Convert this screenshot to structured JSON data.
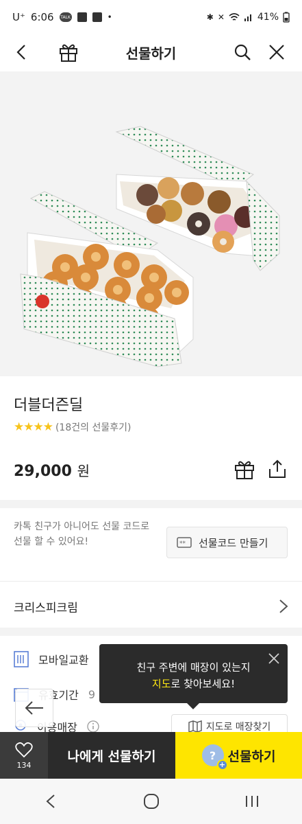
{
  "status_bar": {
    "carrier": "U⁺",
    "time": "6:06",
    "talk_badge": "TALK",
    "battery": "41%"
  },
  "header": {
    "title": "선물하기"
  },
  "product": {
    "name": "더블더즌딜",
    "stars": "★★★★",
    "review_count": "(18건의 선물후기)",
    "price": "29,000",
    "price_unit": "원"
  },
  "gift_code": {
    "line1": "카톡 친구가 아니어도 선물 코드로",
    "line2": "선물 할 수 있어요!",
    "button_label": "선물코드 만들기"
  },
  "brand": {
    "name": "크리스피크림"
  },
  "info": {
    "exchange_label": "모바일교환",
    "validity_label": "유효기간",
    "validity_value": "9",
    "store_label": "이용매장",
    "map_button_label": "지도로 매장찾기"
  },
  "tooltip": {
    "line1": "친구 주변에 매장이 있는지",
    "line2_highlight": "지도",
    "line2_rest": "로 찾아보세요!"
  },
  "bottom_bar": {
    "like_count": "134",
    "self_gift_label": "나에게 선물하기",
    "gift_label": "선물하기"
  },
  "colors": {
    "accent_yellow": "#fee500",
    "star": "#f7c31b",
    "tooltip_highlight": "#ffe812"
  }
}
